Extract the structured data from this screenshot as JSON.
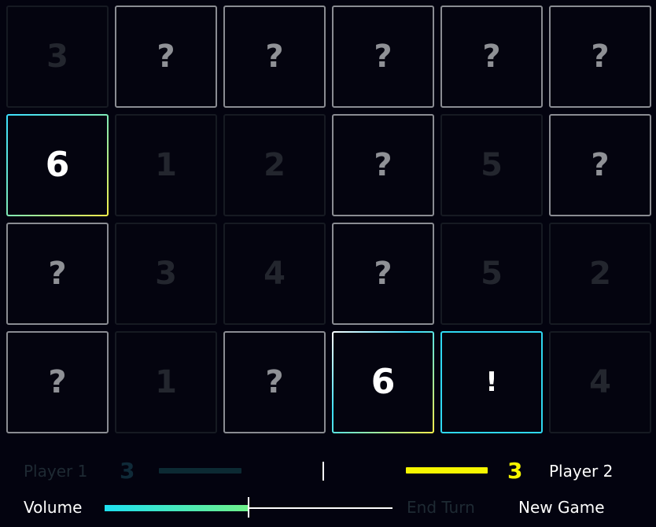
{
  "board": {
    "columns": 6,
    "rows": 4,
    "tiles": [
      {
        "label": "3",
        "state": "matched"
      },
      {
        "label": "?",
        "state": "hidden"
      },
      {
        "label": "?",
        "state": "hidden"
      },
      {
        "label": "?",
        "state": "hidden"
      },
      {
        "label": "?",
        "state": "hidden"
      },
      {
        "label": "?",
        "state": "hidden"
      },
      {
        "label": "6",
        "state": "revealed",
        "style": "sel-a"
      },
      {
        "label": "1",
        "state": "matched"
      },
      {
        "label": "2",
        "state": "matched"
      },
      {
        "label": "?",
        "state": "hidden"
      },
      {
        "label": "5",
        "state": "matched"
      },
      {
        "label": "?",
        "state": "hidden"
      },
      {
        "label": "?",
        "state": "hidden"
      },
      {
        "label": "3",
        "state": "matched"
      },
      {
        "label": "4",
        "state": "matched"
      },
      {
        "label": "?",
        "state": "hidden"
      },
      {
        "label": "5",
        "state": "matched"
      },
      {
        "label": "2",
        "state": "matched"
      },
      {
        "label": "?",
        "state": "hidden"
      },
      {
        "label": "1",
        "state": "matched"
      },
      {
        "label": "?",
        "state": "hidden"
      },
      {
        "label": "6",
        "state": "revealed",
        "style": "sel-b"
      },
      {
        "label": "!",
        "state": "active"
      },
      {
        "label": "4",
        "state": "matched"
      }
    ]
  },
  "players": {
    "p1": {
      "label": "Player 1",
      "score": "3",
      "color": "#0c2a33"
    },
    "p2": {
      "label": "Player 2",
      "score": "3",
      "color": "#f6f600"
    }
  },
  "controls": {
    "volume_label": "Volume",
    "volume_level": 0.5,
    "end_turn_label": "End Turn",
    "new_game_label": "New Game"
  },
  "colors": {
    "background": "#03030f",
    "accent_cyan": "#2fd8f2",
    "accent_yellow": "#f6f600"
  }
}
